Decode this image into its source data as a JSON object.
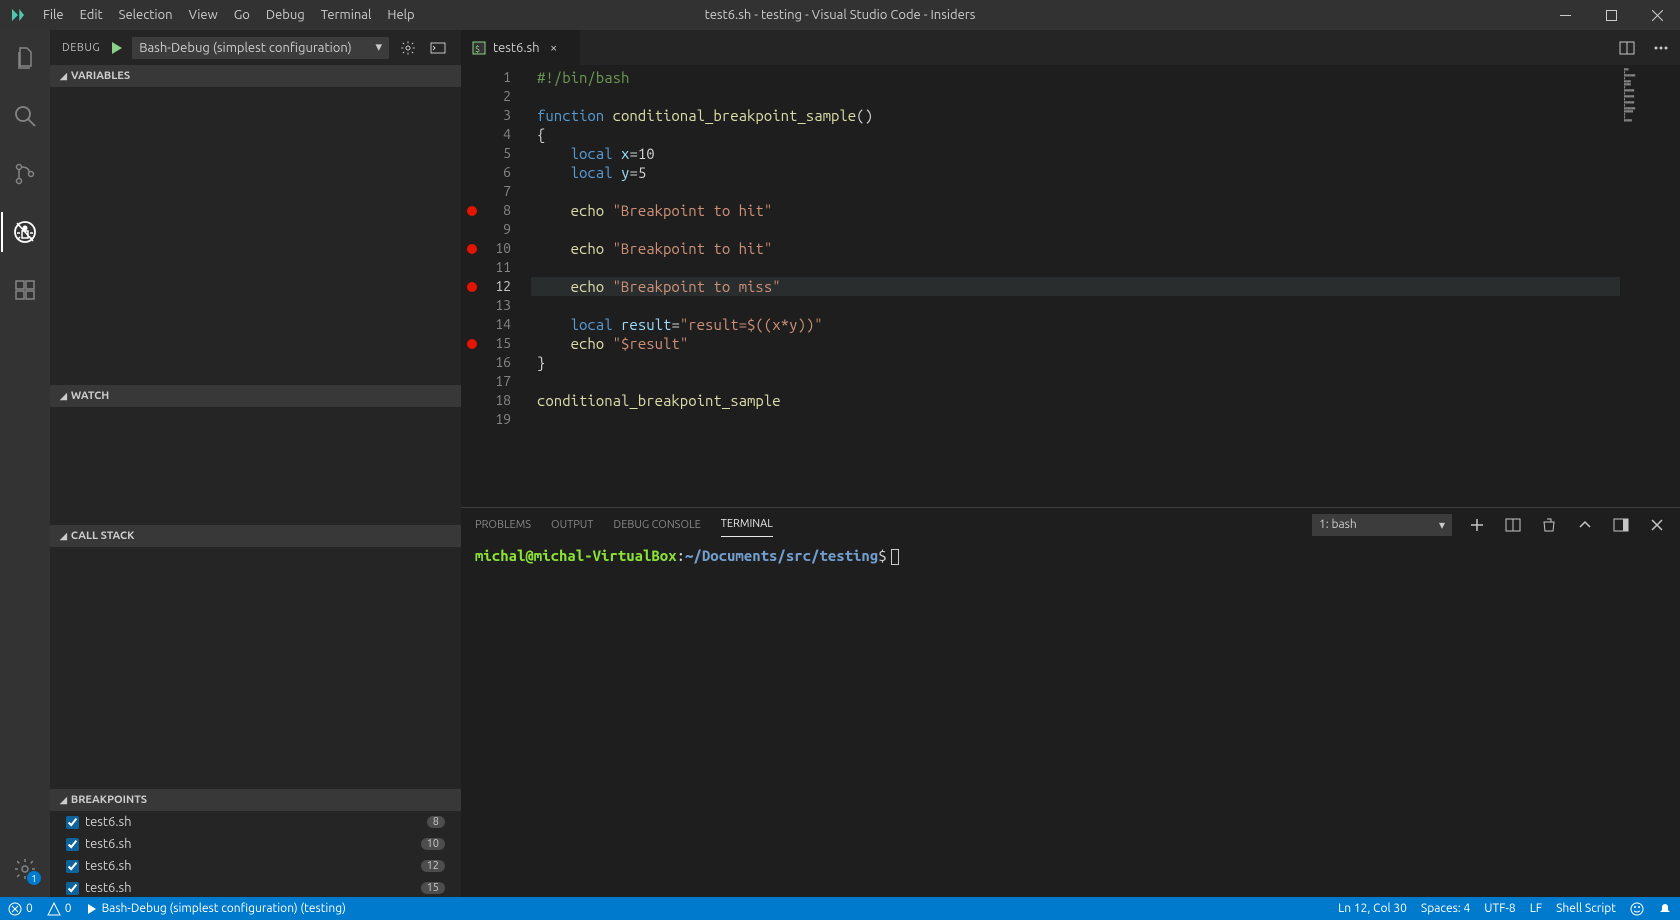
{
  "app": {
    "title": "test6.sh - testing - Visual Studio Code - Insiders"
  },
  "menu": [
    "File",
    "Edit",
    "Selection",
    "View",
    "Go",
    "Debug",
    "Terminal",
    "Help"
  ],
  "activity": {
    "items": [
      "explorer",
      "search",
      "scm",
      "debug",
      "extensions"
    ],
    "settings_badge": "1"
  },
  "debug": {
    "label": "DEBUG",
    "config": "Bash-Debug (simplest configuration)",
    "sections": {
      "variables": "VARIABLES",
      "watch": "WATCH",
      "callstack": "CALL STACK",
      "breakpoints": "BREAKPOINTS"
    },
    "breakpoints": [
      {
        "file": "test6.sh",
        "line": "8"
      },
      {
        "file": "test6.sh",
        "line": "10"
      },
      {
        "file": "test6.sh",
        "line": "12"
      },
      {
        "file": "test6.sh",
        "line": "15"
      }
    ]
  },
  "editor": {
    "tab": {
      "name": "test6.sh"
    },
    "lines": [
      {
        "n": 1,
        "html": "<span class='cm'>#!/bin/bash</span>"
      },
      {
        "n": 2,
        "html": ""
      },
      {
        "n": 3,
        "html": "<span class='kw'>function</span> <span class='fn'>conditional_breakpoint_sample</span><span class='plain'>()</span>"
      },
      {
        "n": 4,
        "html": "<span class='plain'>{</span>"
      },
      {
        "n": 5,
        "html": "    <span class='kw'>local</span> <span class='va'>x</span><span class='plain'>=10</span>"
      },
      {
        "n": 6,
        "html": "    <span class='kw'>local</span> <span class='va'>y</span><span class='plain'>=5</span>"
      },
      {
        "n": 7,
        "html": ""
      },
      {
        "n": 8,
        "bp": true,
        "html": "    <span class='fn'>echo</span> <span class='str'>\"Breakpoint to hit\"</span>"
      },
      {
        "n": 9,
        "html": ""
      },
      {
        "n": 10,
        "bp": true,
        "html": "    <span class='fn'>echo</span> <span class='str'>\"Breakpoint to hit\"</span>"
      },
      {
        "n": 11,
        "html": ""
      },
      {
        "n": 12,
        "bp": true,
        "current": true,
        "html": "    <span class='fn'>echo</span> <span class='str'>\"Breakpoint to miss\"</span>"
      },
      {
        "n": 13,
        "html": ""
      },
      {
        "n": 14,
        "html": "    <span class='kw'>local</span> <span class='va'>result</span><span class='plain'>=</span><span class='str'>\"result=$((x*y))\"</span>"
      },
      {
        "n": 15,
        "bp": true,
        "html": "    <span class='fn'>echo</span> <span class='str'>\"$result\"</span>"
      },
      {
        "n": 16,
        "html": "<span class='plain'>}</span>"
      },
      {
        "n": 17,
        "html": ""
      },
      {
        "n": 18,
        "html": "<span class='fn'>conditional_breakpoint_sample</span>"
      },
      {
        "n": 19,
        "html": ""
      }
    ]
  },
  "terminal": {
    "tabs": [
      "PROBLEMS",
      "OUTPUT",
      "DEBUG CONSOLE",
      "TERMINAL"
    ],
    "select": "1: bash",
    "prompt": {
      "user": "michal@michal-VirtualBox",
      "path": "~/Documents/src/testing",
      "dollar": "$"
    }
  },
  "status": {
    "errors": "0",
    "warnings": "0",
    "launch": "Bash-Debug (simplest configuration) (testing)",
    "position": "Ln 12, Col 30",
    "spaces": "Spaces: 4",
    "encoding": "UTF-8",
    "eol": "LF",
    "lang": "Shell Script"
  }
}
